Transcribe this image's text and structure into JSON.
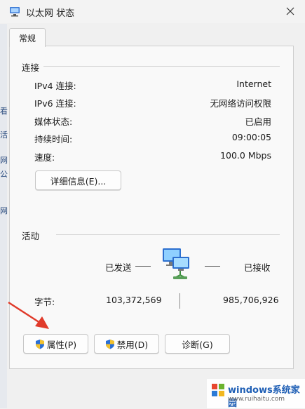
{
  "window": {
    "title": "以太网 状态"
  },
  "background_strip": [
    "看",
    "活",
    "网",
    "公",
    "网"
  ],
  "tabs": [
    {
      "label": "常规"
    }
  ],
  "connection": {
    "title": "连接",
    "rows": [
      {
        "label": "IPv4 连接:",
        "value": "Internet"
      },
      {
        "label": "IPv6 连接:",
        "value": "无网络访问权限"
      },
      {
        "label": "媒体状态:",
        "value": "已启用"
      },
      {
        "label": "持续时间:",
        "value": "09:00:05"
      },
      {
        "label": "速度:",
        "value": "100.0 Mbps"
      }
    ],
    "details_button": "详细信息(E)..."
  },
  "activity": {
    "title": "活动",
    "sent_label": "已发送",
    "received_label": "已接收",
    "bytes_label": "字节:",
    "bytes_sent": "103,372,569",
    "bytes_received": "985,706,926"
  },
  "buttons": {
    "properties": "属性(P)",
    "disable": "禁用(D)",
    "diagnose": "诊断(G)"
  },
  "watermark": {
    "text": "windows系统家园",
    "sub": "www.ruihaitu.com"
  },
  "colors": {
    "annotation_arrow": "#e03a2a",
    "shield_blue": "#2a6fd6",
    "shield_yellow": "#f2c12e"
  }
}
